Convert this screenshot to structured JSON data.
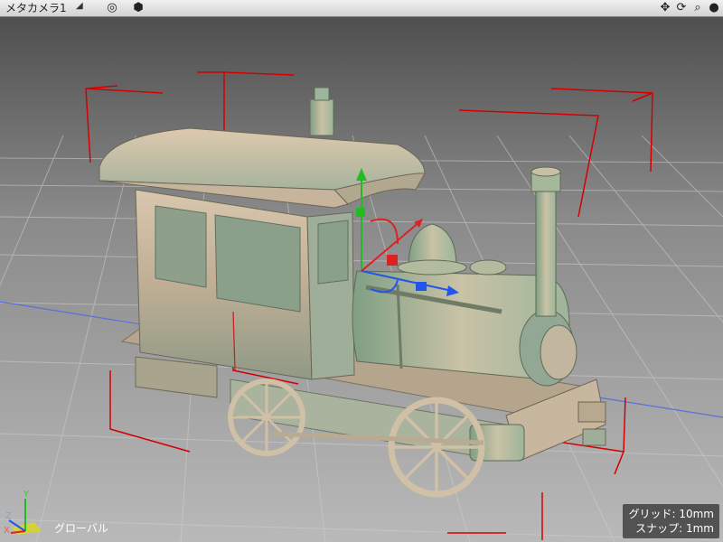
{
  "toolbar": {
    "camera_name": "メタカメラ1",
    "icons": [
      "target-icon",
      "cube-icon",
      "move-icon",
      "rotate-icon",
      "zoom-icon",
      "sphere-icon"
    ]
  },
  "hud": {
    "axis_y": "Y",
    "axis_x": "X",
    "axis_z": "Z",
    "coordinate_mode": "グローバル",
    "grid_label": "グリッド: 10mm",
    "snap_label": "スナップ: 1mm"
  },
  "colors": {
    "model": "#c8b79f",
    "selection_box": "#d40000",
    "manip_y": "#22bb22",
    "manip_x": "#dd2222",
    "manip_z": "#2255ee"
  }
}
